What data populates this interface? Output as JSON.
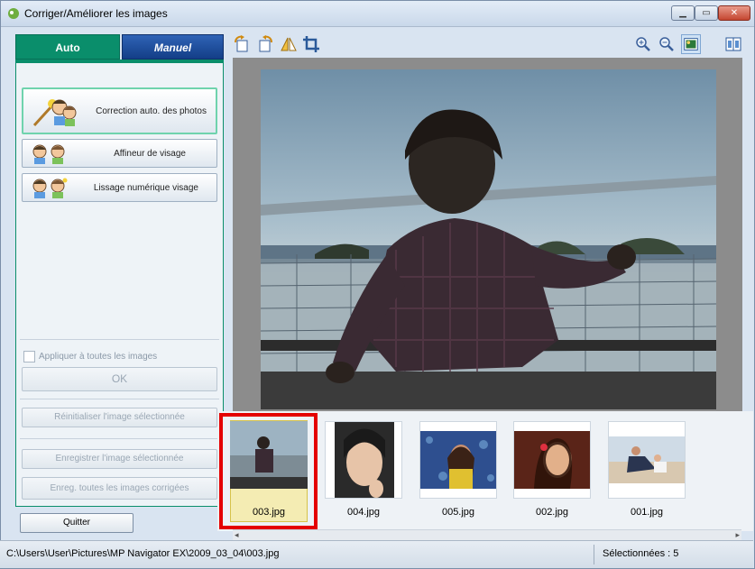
{
  "window": {
    "title": "Corriger/Améliorer les images"
  },
  "tabs": {
    "auto": "Auto",
    "manual": "Manuel"
  },
  "tools": {
    "auto_correct": "Correction auto. des photos",
    "face_sharpener": "Affineur de visage",
    "digital_face_smoothing": "Lissage numérique visage"
  },
  "options": {
    "apply_all": "Appliquer à toutes les images"
  },
  "buttons": {
    "ok": "OK",
    "reset_selected": "Réinitialiser l'image sélectionnée",
    "save_selected": "Enregistrer l'image sélectionnée",
    "save_all": "Enreg. toutes les images corrigées",
    "quit": "Quitter"
  },
  "toolbar": {
    "icons": [
      "rotate-left-icon",
      "rotate-right-icon",
      "flip-icon",
      "crop-icon",
      "zoom-in-icon",
      "zoom-out-icon",
      "full-image-view-icon",
      "compare-view-icon"
    ]
  },
  "thumbnails": [
    {
      "label": "003.jpg",
      "selected": true
    },
    {
      "label": "004.jpg",
      "selected": false
    },
    {
      "label": "005.jpg",
      "selected": false
    },
    {
      "label": "002.jpg",
      "selected": false
    },
    {
      "label": "001.jpg",
      "selected": false
    }
  ],
  "status": {
    "path": "C:\\Users\\User\\Pictures\\MP Navigator EX\\2009_03_04\\003.jpg",
    "selected_count": "Sélectionnées : 5"
  },
  "colors": {
    "auto_tab": "#0a8e6b",
    "manual_tab": "#1e4c9a",
    "selection_highlight": "#e40000"
  }
}
